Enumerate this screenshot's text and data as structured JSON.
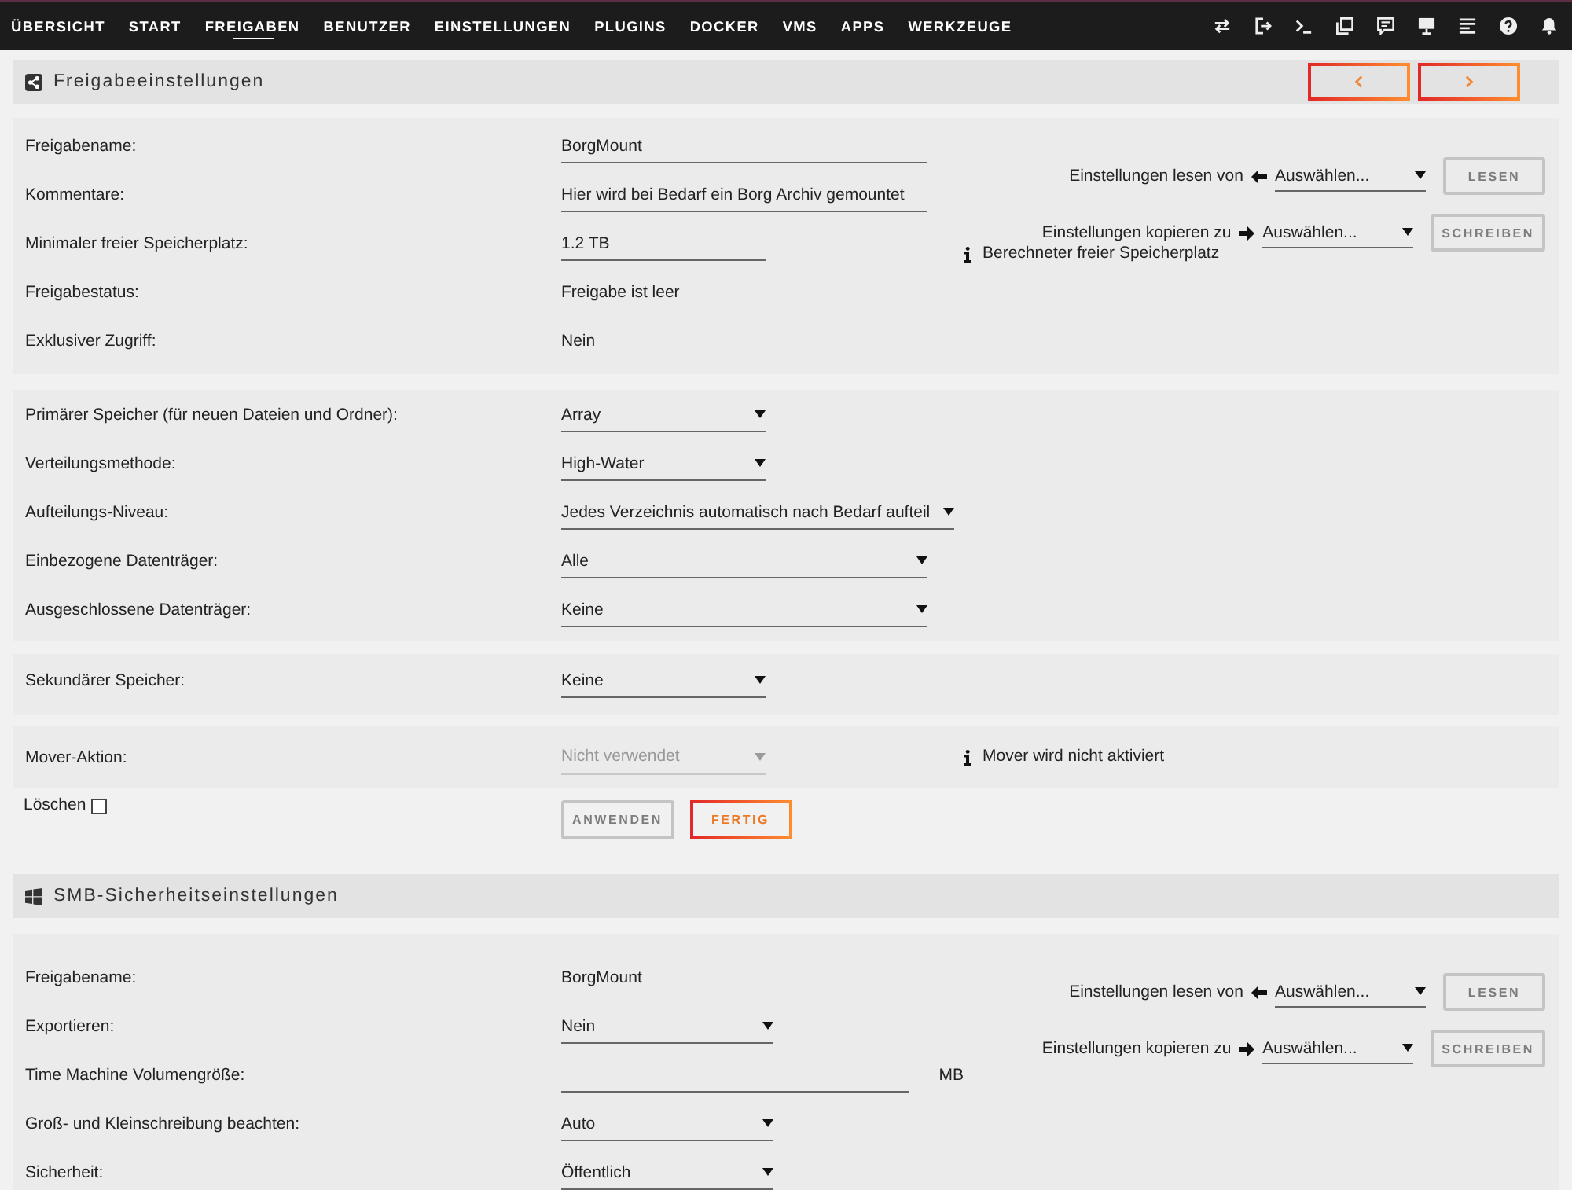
{
  "nav": {
    "items": [
      {
        "label": "ÜBERSICHT",
        "selected": false
      },
      {
        "label": "START",
        "selected": false
      },
      {
        "label": "FREIGABEN",
        "selected": true
      },
      {
        "label": "BENUTZER",
        "selected": false
      },
      {
        "label": "EINSTELLUNGEN",
        "selected": false
      },
      {
        "label": "PLUGINS",
        "selected": false
      },
      {
        "label": "DOCKER",
        "selected": false
      },
      {
        "label": "VMS",
        "selected": false
      },
      {
        "label": "APPS",
        "selected": false
      },
      {
        "label": "WERKZEUGE",
        "selected": false
      }
    ]
  },
  "share_settings": {
    "title": "Freigabeeinstellungen",
    "general": {
      "fields": [
        {
          "label": "Freigabename:",
          "kind": "input",
          "value": "BorgMount"
        },
        {
          "label": "Kommentare:",
          "kind": "input",
          "value": "Hier wird bei Bedarf ein Borg Archiv gemountet"
        },
        {
          "label": "Minimaler freier Speicherplatz:",
          "kind": "input",
          "value": "1.2 TB"
        },
        {
          "label": "Freigabestatus:",
          "kind": "text",
          "value": "Freigabe ist leer"
        },
        {
          "label": "Exklusiver Zugriff:",
          "kind": "text",
          "value": "Nein"
        }
      ],
      "read_from": {
        "label": "Einstellungen lesen von",
        "value": "Auswählen...",
        "button": {
          "label": "LESEN",
          "disabled": true
        }
      },
      "copy_to": {
        "label": "Einstellungen kopieren zu",
        "value": "Auswählen...",
        "button": {
          "label": "SCHREIBEN",
          "disabled": true
        }
      },
      "info": "Berechneter freier Speicherplatz"
    },
    "storage": {
      "fields": [
        {
          "label": "Primärer Speicher (für neuen Dateien und Ordner):",
          "kind": "select",
          "value": "Array"
        },
        {
          "label": "Verteilungsmethode:",
          "kind": "select",
          "value": "High-Water"
        },
        {
          "label": "Aufteilungs-Niveau:",
          "kind": "select",
          "value": "Jedes Verzeichnis automatisch nach Bedarf aufteil"
        },
        {
          "label": "Einbezogene Datenträger:",
          "kind": "select",
          "value": "Alle"
        },
        {
          "label": "Ausgeschlossene Datenträger:",
          "kind": "select",
          "value": "Keine"
        }
      ]
    },
    "secondary": {
      "fields": [
        {
          "label": "Sekundärer Speicher:",
          "kind": "select",
          "value": "Keine"
        }
      ]
    },
    "mover": {
      "fields": [
        {
          "label": "Mover-Aktion:",
          "kind": "select",
          "value": "Nicht verwendet",
          "disabled": true
        }
      ],
      "info": "Mover wird nicht aktiviert"
    },
    "delete": {
      "label": "Löschen",
      "checked": false
    },
    "buttons": [
      {
        "label": "ANWENDEN",
        "disabled": true
      },
      {
        "label": "FERTIG",
        "disabled": false
      }
    ]
  },
  "smb_settings": {
    "title": "SMB-Sicherheitseinstellungen",
    "fields": [
      {
        "label": "Freigabename:",
        "kind": "text",
        "value": "BorgMount"
      },
      {
        "label": "Exportieren:",
        "kind": "select",
        "value": "Nein"
      },
      {
        "label": "Time Machine Volumengröße:",
        "kind": "input",
        "unit": "MB"
      },
      {
        "label": "Groß- und Kleinschreibung beachten:",
        "kind": "select",
        "value": "Auto"
      },
      {
        "label": "Sicherheit:",
        "kind": "select",
        "value": "Öffentlich"
      }
    ],
    "read_from": {
      "label": "Einstellungen lesen von",
      "value": "Auswählen...",
      "button": {
        "label": "LESEN",
        "disabled": true
      }
    },
    "copy_to": {
      "label": "Einstellungen kopieren zu",
      "value": "Auswählen...",
      "button": {
        "label": "SCHREIBEN",
        "disabled": true
      }
    }
  }
}
